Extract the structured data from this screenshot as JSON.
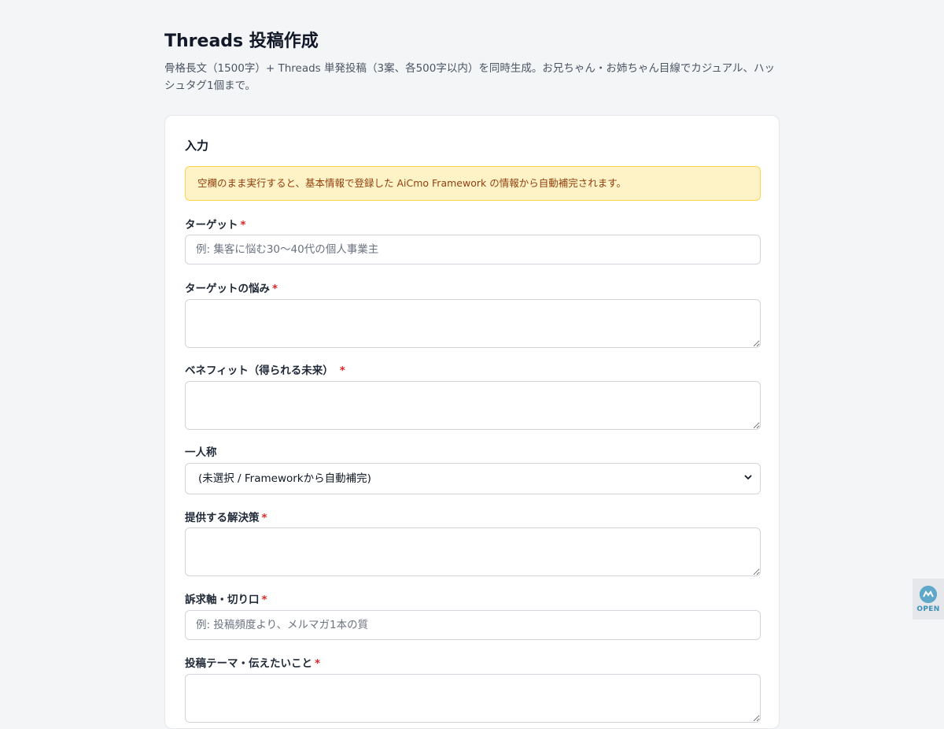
{
  "header": {
    "title": "Threads 投稿作成",
    "description": "骨格長文（1500字）+ Threads 単発投稿（3案、各500字以内）を同時生成。お兄ちゃん・お姉ちゃん目線でカジュアル、ハッシュタグ1個まで。"
  },
  "form": {
    "title": "入力",
    "notice": "空欄のまま実行すると、基本情報で登録した AiCmo Framework の情報から自動補完されます。",
    "required_mark": "*",
    "fields": {
      "target": {
        "label": "ターゲット",
        "placeholder": "例: 集客に悩む30〜40代の個人事業主",
        "value": ""
      },
      "pain": {
        "label": "ターゲットの悩み",
        "value": ""
      },
      "benefit": {
        "label": "ベネフィット（得られる未来）",
        "value": ""
      },
      "first_person": {
        "label": "一人称",
        "selected": "(未選択 / Frameworkから自動補完)"
      },
      "solution": {
        "label": "提供する解決策",
        "value": ""
      },
      "appeal": {
        "label": "訴求軸・切り口",
        "placeholder": "例: 投稿頻度より、メルマガ1本の質",
        "value": ""
      },
      "theme": {
        "label": "投稿テーマ・伝えたいこと",
        "value": ""
      }
    }
  },
  "widget": {
    "label": "OPEN",
    "icon": "chat-bubble-icon"
  },
  "icons": {
    "select_chevron": "chevron-down-icon"
  },
  "colors": {
    "required": "#dc2626",
    "notice_bg": "#fef3c7",
    "notice_text": "#92400e",
    "widget_accent": "#3c8fb5"
  }
}
